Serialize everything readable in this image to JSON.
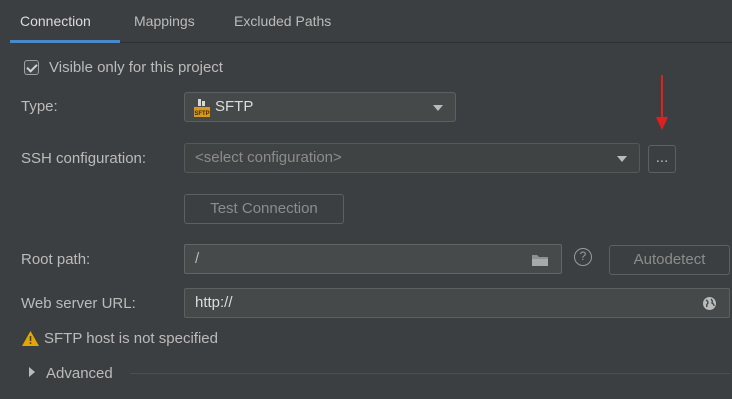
{
  "tabs": [
    {
      "label": "Connection"
    },
    {
      "label": "Mappings"
    },
    {
      "label": "Excluded Paths"
    }
  ],
  "visible_only": {
    "label": "Visible only for this project",
    "checked": true
  },
  "type": {
    "label": "Type:",
    "value": "SFTP",
    "icon": "sftp-icon"
  },
  "ssh": {
    "label": "SSH configuration:",
    "placeholder": "<select configuration>",
    "browse_label": "..."
  },
  "test_connection": {
    "label": "Test Connection"
  },
  "root_path": {
    "label": "Root path:",
    "value": "/",
    "autodetect_label": "Autodetect",
    "help_glyph": "?"
  },
  "web_server": {
    "label": "Web server URL:",
    "value": "http://"
  },
  "warning": {
    "text": "SFTP host is not specified",
    "color": "#e0a800"
  },
  "advanced": {
    "label": "Advanced"
  },
  "colors": {
    "accent": "#4a88c7",
    "arrow": "#e02020"
  }
}
